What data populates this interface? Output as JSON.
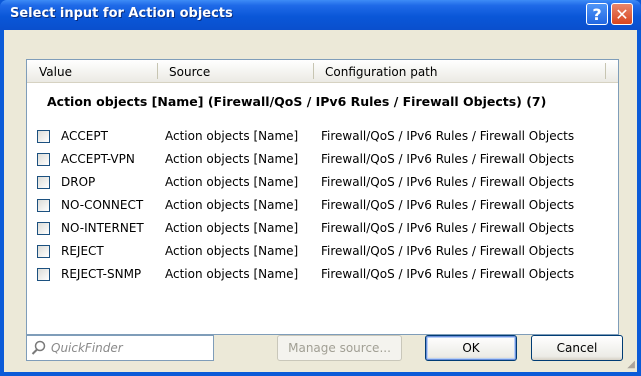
{
  "window": {
    "title": "Select input for Action objects",
    "help_label": "?",
    "close_label": "✕"
  },
  "columns": [
    "Value",
    "Source",
    "Configuration path"
  ],
  "group": {
    "title": "Action objects [Name] (Firewall/QoS / IPv6 Rules / Firewall Objects) (7)"
  },
  "rows": [
    {
      "value": "ACCEPT",
      "source": "Action objects [Name]",
      "path": "Firewall/QoS / IPv6 Rules / Firewall Objects",
      "checked": false
    },
    {
      "value": "ACCEPT-VPN",
      "source": "Action objects [Name]",
      "path": "Firewall/QoS / IPv6 Rules / Firewall Objects",
      "checked": false
    },
    {
      "value": "DROP",
      "source": "Action objects [Name]",
      "path": "Firewall/QoS / IPv6 Rules / Firewall Objects",
      "checked": false
    },
    {
      "value": "NO-CONNECT",
      "source": "Action objects [Name]",
      "path": "Firewall/QoS / IPv6 Rules / Firewall Objects",
      "checked": false
    },
    {
      "value": "NO-INTERNET",
      "source": "Action objects [Name]",
      "path": "Firewall/QoS / IPv6 Rules / Firewall Objects",
      "checked": false
    },
    {
      "value": "REJECT",
      "source": "Action objects [Name]",
      "path": "Firewall/QoS / IPv6 Rules / Firewall Objects",
      "checked": false
    },
    {
      "value": "REJECT-SNMP",
      "source": "Action objects [Name]",
      "path": "Firewall/QoS / IPv6 Rules / Firewall Objects",
      "checked": false
    }
  ],
  "quickfinder": {
    "placeholder": "QuickFinder",
    "icon": "search-icon"
  },
  "buttons": {
    "manage_source": "Manage source...",
    "ok": "OK",
    "cancel": "Cancel"
  },
  "colors": {
    "titlebar": "#0a57d8",
    "dialog_bg": "#ece9d8",
    "close_button": "#d9461f"
  }
}
